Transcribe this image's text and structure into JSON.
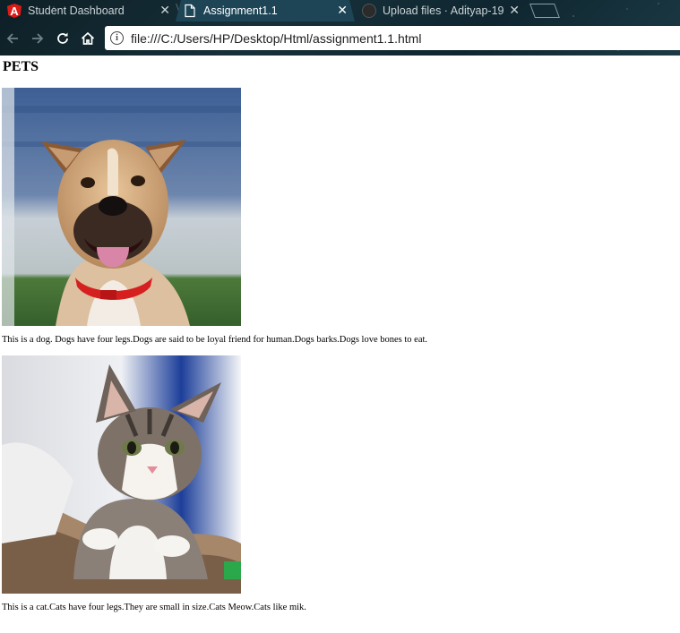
{
  "browser": {
    "tabs": [
      {
        "title": "Student Dashboard",
        "active": false,
        "icon": "angular-icon"
      },
      {
        "title": "Assignment1.1",
        "active": true,
        "icon": "document-icon"
      },
      {
        "title": "Upload files · Adityap-19",
        "active": false,
        "icon": "github-icon"
      }
    ],
    "close_glyph": "✕",
    "url": "file:///C:/Users/HP/Desktop/Html/assignment1.1.html",
    "icons": {
      "back": "arrow-left-icon",
      "forward": "arrow-right-icon",
      "reload": "reload-icon",
      "home": "home-icon",
      "info": "info-icon"
    },
    "colors": {
      "frame": "#16303a",
      "active_tab": "#1d4556",
      "angular_red": "#dd1b16"
    }
  },
  "page": {
    "heading": "PETS",
    "pets": [
      {
        "image": "dog-photo",
        "description": "This is a dog. Dogs have four legs.Dogs are said to be loyal friend for human.Dogs barks.Dogs love bones to eat."
      },
      {
        "image": "cat-photo",
        "description": "This is a cat.Cats have four legs.They are small in size.Cats Meow.Cats like mik."
      }
    ]
  }
}
